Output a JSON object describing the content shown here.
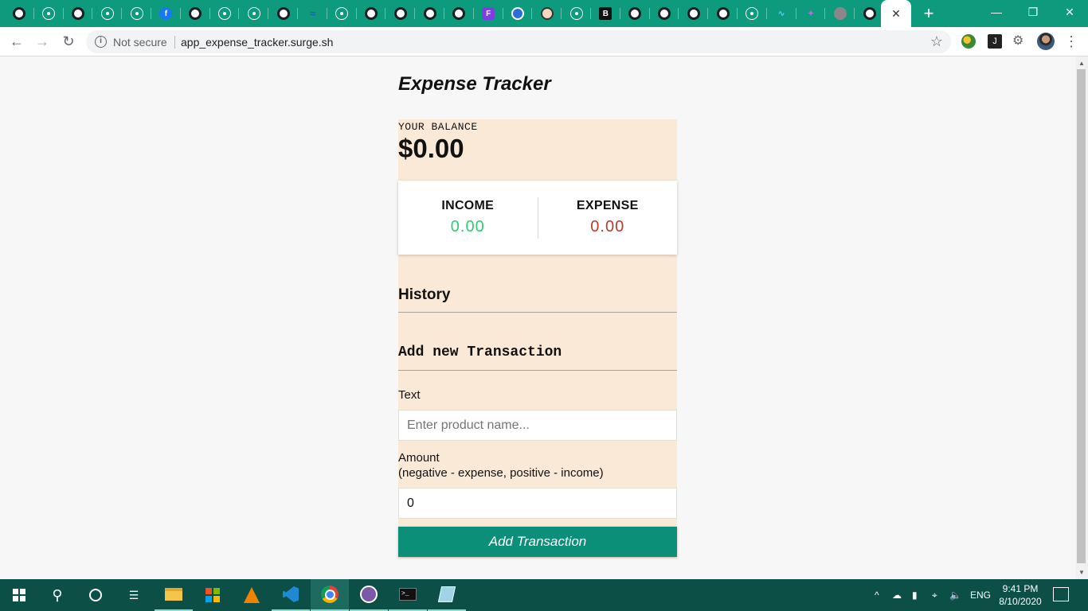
{
  "browser": {
    "tab_icons": [
      "github-icon",
      "react-icon",
      "github-icon",
      "react-icon",
      "react-icon",
      "facebook-icon",
      "github-icon",
      "react-icon",
      "react-icon",
      "github-icon",
      "surge-icon",
      "react-icon",
      "github-icon",
      "github-icon",
      "github-icon",
      "github-icon",
      "purple-f-icon",
      "blue-round-icon",
      "person-icon",
      "react-icon",
      "black-square-icon",
      "github-icon",
      "github-icon",
      "github-icon",
      "github-icon",
      "react-icon",
      "wave-icon",
      "feather-icon",
      "grey-globe-icon",
      "github-icon"
    ],
    "active_tab_close": "✕",
    "new_tab": "+",
    "security_label": "Not secure",
    "url": "app_expense_tracker.surge.sh"
  },
  "app": {
    "title": "Expense Tracker",
    "balance_label": "YOUR BALANCE",
    "balance_value": "$0.00",
    "income_label": "INCOME",
    "income_value": "0.00",
    "expense_label": "EXPENSE",
    "expense_value": "0.00",
    "history_heading": "History",
    "add_heading": "Add new Transaction",
    "text_label": "Text",
    "text_placeholder": "Enter product name...",
    "amount_label": "Amount",
    "amount_hint": "(negative - expense, positive - income)",
    "amount_value": "0",
    "submit_label": "Add Transaction"
  },
  "taskbar": {
    "lang": "ENG",
    "time": "9:41 PM",
    "date": "8/10/2020"
  },
  "colors": {
    "tabstrip": "#0e9a7c",
    "panel": "#fbe9d7",
    "income": "#2ecc71",
    "expense": "#c0392b",
    "button": "#0c8f78",
    "taskbar": "#0b4f47"
  }
}
